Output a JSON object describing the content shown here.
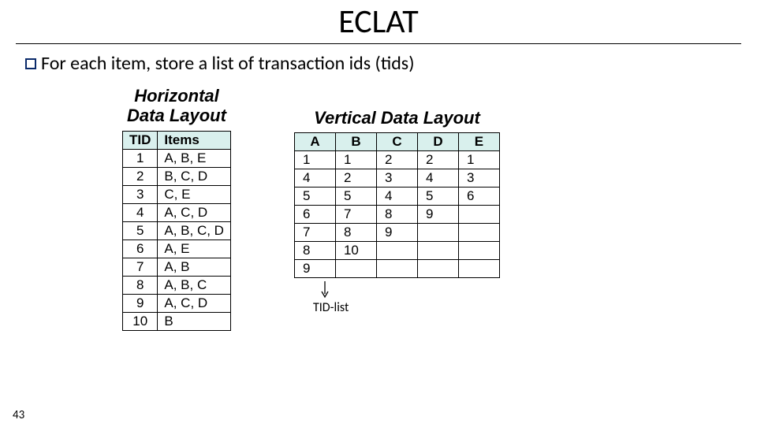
{
  "title": "ECLAT",
  "bullet": "For each item, store a list of transaction ids (tids)",
  "horizontal": {
    "heading": "Horizontal\nData Layout",
    "cols": [
      "TID",
      "Items"
    ],
    "rows": [
      [
        "1",
        "A, B, E"
      ],
      [
        "2",
        "B, C, D"
      ],
      [
        "3",
        "C, E"
      ],
      [
        "4",
        "A, C, D"
      ],
      [
        "5",
        "A, B, C, D"
      ],
      [
        "6",
        "A, E"
      ],
      [
        "7",
        "A, B"
      ],
      [
        "8",
        "A, B, C"
      ],
      [
        "9",
        "A, C, D"
      ],
      [
        "10",
        "B"
      ]
    ]
  },
  "vertical": {
    "heading": "Vertical Data Layout",
    "cols": [
      "A",
      "B",
      "C",
      "D",
      "E"
    ],
    "rows": [
      [
        "1",
        "1",
        "2",
        "2",
        "1"
      ],
      [
        "4",
        "2",
        "3",
        "4",
        "3"
      ],
      [
        "5",
        "5",
        "4",
        "5",
        "6"
      ],
      [
        "6",
        "7",
        "8",
        "9",
        ""
      ],
      [
        "7",
        "8",
        "9",
        "",
        ""
      ],
      [
        "8",
        "10",
        "",
        "",
        ""
      ],
      [
        "9",
        "",
        "",
        "",
        ""
      ]
    ],
    "arrow_label": "TID-list"
  },
  "page_number": "43"
}
